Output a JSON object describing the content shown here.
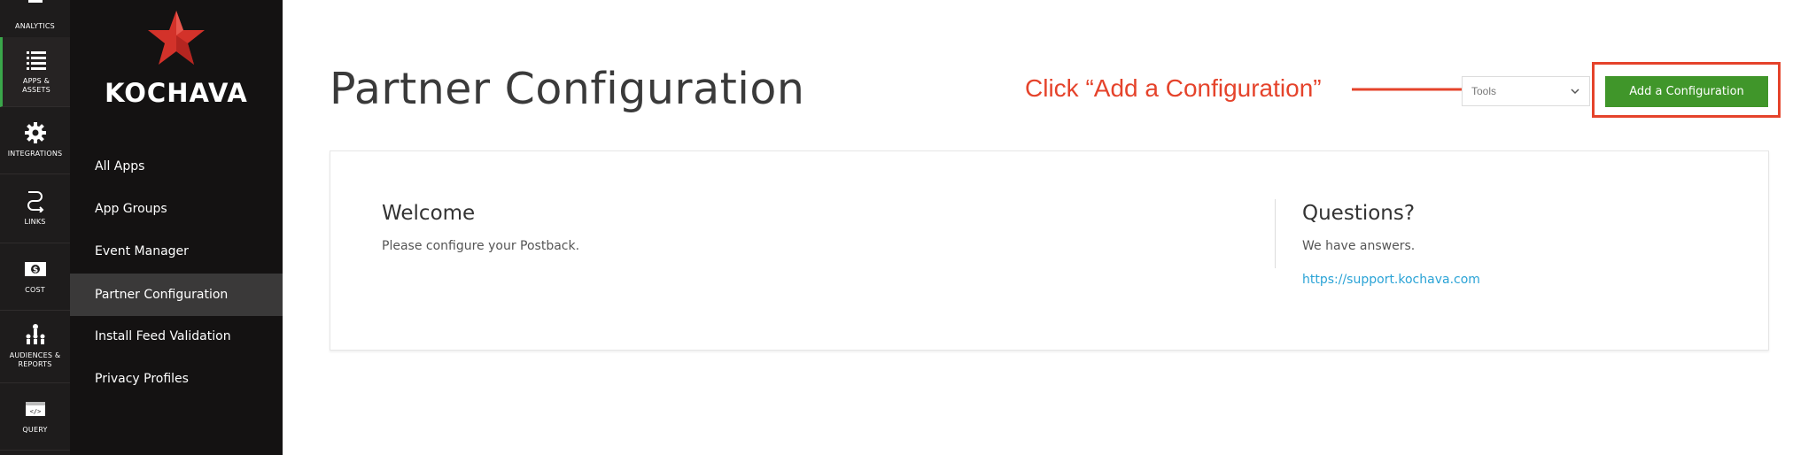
{
  "rail": {
    "items": [
      {
        "label": "ANALYTICS",
        "icon": "analytics-icon"
      },
      {
        "label": "APPS & ASSETS",
        "icon": "list-icon",
        "active": true
      },
      {
        "label": "INTEGRATIONS",
        "icon": "gear-icon"
      },
      {
        "label": "LINKS",
        "icon": "links-icon"
      },
      {
        "label": "COST",
        "icon": "dollar-icon"
      },
      {
        "label": "AUDIENCES & REPORTS",
        "icon": "audience-icon"
      },
      {
        "label": "QUERY",
        "icon": "code-icon"
      }
    ]
  },
  "nav": {
    "logo_text": "KOCHAVA",
    "items": [
      {
        "label": "All Apps"
      },
      {
        "label": "App Groups"
      },
      {
        "label": "Event Manager"
      },
      {
        "label": "Partner Configuration",
        "active": true
      },
      {
        "label": "Install Feed Validation"
      },
      {
        "label": "Privacy Profiles"
      }
    ]
  },
  "header": {
    "title": "Partner Configuration",
    "tools_select_value": "Tools",
    "add_button_label": "Add a Configuration"
  },
  "annotation": {
    "text": "Click “Add a Configuration”",
    "color": "#e5432b"
  },
  "welcome": {
    "heading": "Welcome",
    "text": "Please configure your Postback."
  },
  "questions": {
    "heading": "Questions?",
    "text": "We have answers.",
    "link": "https://support.kochava.com"
  },
  "colors": {
    "accent_green": "#40962a",
    "logo_red": "#d3322a",
    "link_blue": "#2aa3d6"
  }
}
